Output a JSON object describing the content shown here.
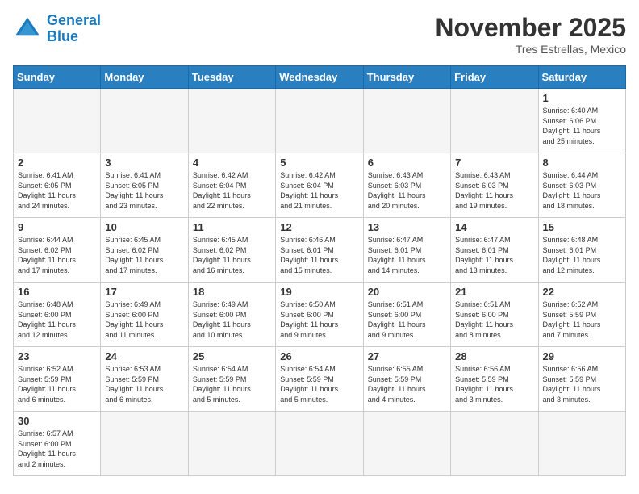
{
  "header": {
    "logo_general": "General",
    "logo_blue": "Blue",
    "month": "November 2025",
    "location": "Tres Estrellas, Mexico"
  },
  "days_of_week": [
    "Sunday",
    "Monday",
    "Tuesday",
    "Wednesday",
    "Thursday",
    "Friday",
    "Saturday"
  ],
  "weeks": [
    [
      {
        "num": "",
        "info": ""
      },
      {
        "num": "",
        "info": ""
      },
      {
        "num": "",
        "info": ""
      },
      {
        "num": "",
        "info": ""
      },
      {
        "num": "",
        "info": ""
      },
      {
        "num": "",
        "info": ""
      },
      {
        "num": "1",
        "info": "Sunrise: 6:40 AM\nSunset: 6:06 PM\nDaylight: 11 hours\nand 25 minutes."
      }
    ],
    [
      {
        "num": "2",
        "info": "Sunrise: 6:41 AM\nSunset: 6:05 PM\nDaylight: 11 hours\nand 24 minutes."
      },
      {
        "num": "3",
        "info": "Sunrise: 6:41 AM\nSunset: 6:05 PM\nDaylight: 11 hours\nand 23 minutes."
      },
      {
        "num": "4",
        "info": "Sunrise: 6:42 AM\nSunset: 6:04 PM\nDaylight: 11 hours\nand 22 minutes."
      },
      {
        "num": "5",
        "info": "Sunrise: 6:42 AM\nSunset: 6:04 PM\nDaylight: 11 hours\nand 21 minutes."
      },
      {
        "num": "6",
        "info": "Sunrise: 6:43 AM\nSunset: 6:03 PM\nDaylight: 11 hours\nand 20 minutes."
      },
      {
        "num": "7",
        "info": "Sunrise: 6:43 AM\nSunset: 6:03 PM\nDaylight: 11 hours\nand 19 minutes."
      },
      {
        "num": "8",
        "info": "Sunrise: 6:44 AM\nSunset: 6:03 PM\nDaylight: 11 hours\nand 18 minutes."
      }
    ],
    [
      {
        "num": "9",
        "info": "Sunrise: 6:44 AM\nSunset: 6:02 PM\nDaylight: 11 hours\nand 17 minutes."
      },
      {
        "num": "10",
        "info": "Sunrise: 6:45 AM\nSunset: 6:02 PM\nDaylight: 11 hours\nand 17 minutes."
      },
      {
        "num": "11",
        "info": "Sunrise: 6:45 AM\nSunset: 6:02 PM\nDaylight: 11 hours\nand 16 minutes."
      },
      {
        "num": "12",
        "info": "Sunrise: 6:46 AM\nSunset: 6:01 PM\nDaylight: 11 hours\nand 15 minutes."
      },
      {
        "num": "13",
        "info": "Sunrise: 6:47 AM\nSunset: 6:01 PM\nDaylight: 11 hours\nand 14 minutes."
      },
      {
        "num": "14",
        "info": "Sunrise: 6:47 AM\nSunset: 6:01 PM\nDaylight: 11 hours\nand 13 minutes."
      },
      {
        "num": "15",
        "info": "Sunrise: 6:48 AM\nSunset: 6:01 PM\nDaylight: 11 hours\nand 12 minutes."
      }
    ],
    [
      {
        "num": "16",
        "info": "Sunrise: 6:48 AM\nSunset: 6:00 PM\nDaylight: 11 hours\nand 12 minutes."
      },
      {
        "num": "17",
        "info": "Sunrise: 6:49 AM\nSunset: 6:00 PM\nDaylight: 11 hours\nand 11 minutes."
      },
      {
        "num": "18",
        "info": "Sunrise: 6:49 AM\nSunset: 6:00 PM\nDaylight: 11 hours\nand 10 minutes."
      },
      {
        "num": "19",
        "info": "Sunrise: 6:50 AM\nSunset: 6:00 PM\nDaylight: 11 hours\nand 9 minutes."
      },
      {
        "num": "20",
        "info": "Sunrise: 6:51 AM\nSunset: 6:00 PM\nDaylight: 11 hours\nand 9 minutes."
      },
      {
        "num": "21",
        "info": "Sunrise: 6:51 AM\nSunset: 6:00 PM\nDaylight: 11 hours\nand 8 minutes."
      },
      {
        "num": "22",
        "info": "Sunrise: 6:52 AM\nSunset: 5:59 PM\nDaylight: 11 hours\nand 7 minutes."
      }
    ],
    [
      {
        "num": "23",
        "info": "Sunrise: 6:52 AM\nSunset: 5:59 PM\nDaylight: 11 hours\nand 6 minutes."
      },
      {
        "num": "24",
        "info": "Sunrise: 6:53 AM\nSunset: 5:59 PM\nDaylight: 11 hours\nand 6 minutes."
      },
      {
        "num": "25",
        "info": "Sunrise: 6:54 AM\nSunset: 5:59 PM\nDaylight: 11 hours\nand 5 minutes."
      },
      {
        "num": "26",
        "info": "Sunrise: 6:54 AM\nSunset: 5:59 PM\nDaylight: 11 hours\nand 5 minutes."
      },
      {
        "num": "27",
        "info": "Sunrise: 6:55 AM\nSunset: 5:59 PM\nDaylight: 11 hours\nand 4 minutes."
      },
      {
        "num": "28",
        "info": "Sunrise: 6:56 AM\nSunset: 5:59 PM\nDaylight: 11 hours\nand 3 minutes."
      },
      {
        "num": "29",
        "info": "Sunrise: 6:56 AM\nSunset: 5:59 PM\nDaylight: 11 hours\nand 3 minutes."
      }
    ],
    [
      {
        "num": "30",
        "info": "Sunrise: 6:57 AM\nSunset: 6:00 PM\nDaylight: 11 hours\nand 2 minutes."
      },
      {
        "num": "",
        "info": ""
      },
      {
        "num": "",
        "info": ""
      },
      {
        "num": "",
        "info": ""
      },
      {
        "num": "",
        "info": ""
      },
      {
        "num": "",
        "info": ""
      },
      {
        "num": "",
        "info": ""
      }
    ]
  ]
}
